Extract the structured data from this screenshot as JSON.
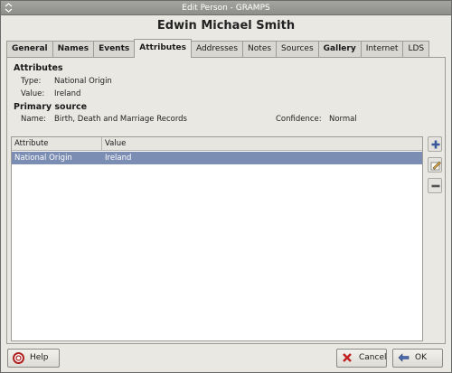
{
  "window": {
    "title": "Edit Person - GRAMPS"
  },
  "person_name": "Edwin Michael Smith",
  "tabs": [
    {
      "label": "General",
      "bold": true,
      "active": false
    },
    {
      "label": "Names",
      "bold": true,
      "active": false
    },
    {
      "label": "Events",
      "bold": true,
      "active": false
    },
    {
      "label": "Attributes",
      "bold": true,
      "active": true
    },
    {
      "label": "Addresses",
      "bold": false,
      "active": false
    },
    {
      "label": "Notes",
      "bold": false,
      "active": false
    },
    {
      "label": "Sources",
      "bold": false,
      "active": false
    },
    {
      "label": "Gallery",
      "bold": true,
      "active": false
    },
    {
      "label": "Internet",
      "bold": false,
      "active": false
    },
    {
      "label": "LDS",
      "bold": false,
      "active": false
    }
  ],
  "attributes_section": {
    "heading": "Attributes",
    "type_label": "Type:",
    "type_value": "National Origin",
    "value_label": "Value:",
    "value_value": "Ireland"
  },
  "primary_source": {
    "heading": "Primary source",
    "name_label": "Name:",
    "name_value": "Birth, Death and Marriage Records",
    "confidence_label": "Confidence:",
    "confidence_value": "Normal"
  },
  "table": {
    "columns": [
      "Attribute",
      "Value"
    ],
    "rows": [
      {
        "attribute": "National Origin",
        "value": "Ireland",
        "selected": true
      }
    ]
  },
  "side_buttons": {
    "add_icon": "add-icon",
    "edit_icon": "edit-icon",
    "remove_icon": "remove-icon"
  },
  "buttons": {
    "help": "Help",
    "cancel": "Cancel",
    "ok": "OK"
  },
  "colors": {
    "selection": "#7b8db2",
    "titlebar": "#9a9a96",
    "add": "#3a5a9a"
  }
}
